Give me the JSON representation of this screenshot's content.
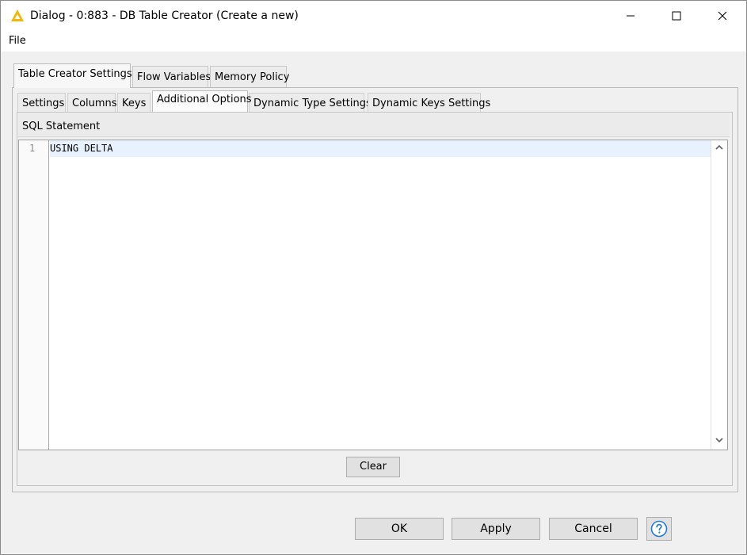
{
  "window": {
    "title": "Dialog - 0:883 - DB Table Creator (Create a new)",
    "icon": "knime-triangle-icon"
  },
  "menu": {
    "items": [
      "File"
    ]
  },
  "outer_tabs": {
    "items": [
      "Table Creator Settings",
      "Flow Variables",
      "Memory Policy"
    ],
    "active": "Table Creator Settings"
  },
  "inner_tabs": {
    "items": [
      "Settings",
      "Columns",
      "Keys",
      "Additional Options",
      "Dynamic Type Settings",
      "Dynamic Keys Settings"
    ],
    "active": "Additional Options"
  },
  "sql": {
    "label": "SQL Statement",
    "line_number": "1",
    "code": "USING DELTA"
  },
  "buttons": {
    "clear": "Clear",
    "ok": "OK",
    "apply": "Apply",
    "cancel": "Cancel"
  },
  "colors": {
    "accent_icon": "#f2b705",
    "help_icon": "#1e7bd7",
    "current_line": "#e8f2fe"
  }
}
